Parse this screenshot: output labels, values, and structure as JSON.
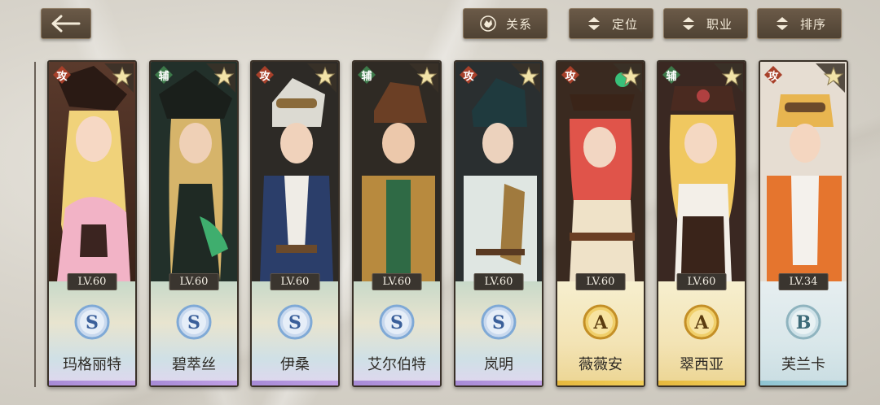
{
  "header": {
    "back_icon": "left-arrow-icon",
    "buttons": [
      {
        "id": "relation",
        "label": "关系",
        "icon": "relation-emblem-icon"
      },
      {
        "id": "position",
        "label": "定位",
        "icon": "updown-arrows-icon"
      },
      {
        "id": "class",
        "label": "职业",
        "icon": "updown-arrows-icon"
      },
      {
        "id": "sort",
        "label": "排序",
        "icon": "updown-arrows-icon"
      }
    ]
  },
  "colors": {
    "button_bg": "#5c4d3d",
    "attack_tag": "#a8402a",
    "support_tag": "#3d7a4a",
    "s_rank": "#7fa9d6",
    "a_rank": "#d9a93a",
    "b_rank": "#9fc2cc"
  },
  "characters": [
    {
      "name": "玛格丽特",
      "level": "LV.60",
      "role": "攻",
      "rank": "S"
    },
    {
      "name": "碧萃丝",
      "level": "LV.60",
      "role": "辅",
      "rank": "S"
    },
    {
      "name": "伊桑",
      "level": "LV.60",
      "role": "攻",
      "rank": "S"
    },
    {
      "name": "艾尔伯特",
      "level": "LV.60",
      "role": "辅",
      "rank": "S"
    },
    {
      "name": "岚明",
      "level": "LV.60",
      "role": "攻",
      "rank": "S"
    },
    {
      "name": "薇薇安",
      "level": "LV.60",
      "role": "攻",
      "rank": "A"
    },
    {
      "name": "翠西亚",
      "level": "LV.60",
      "role": "辅",
      "rank": "A"
    },
    {
      "name": "芙兰卡",
      "level": "LV.34",
      "role": "攻",
      "rank": "B"
    }
  ]
}
